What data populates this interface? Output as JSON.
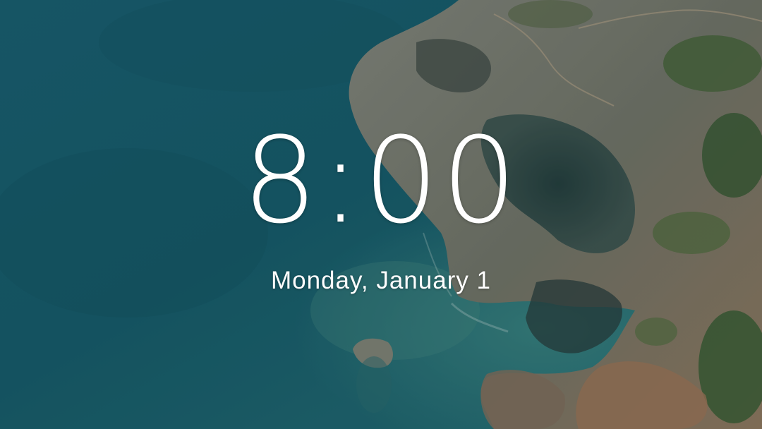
{
  "lockscreen": {
    "time": "8:00",
    "date": "Monday, January 1"
  },
  "colors": {
    "sea_deep": "#145467",
    "sea_shallow": "#2e7f84",
    "cliff": "#8f8a7c",
    "vegetation": "#4e6b3a",
    "text": "#ffffff"
  }
}
